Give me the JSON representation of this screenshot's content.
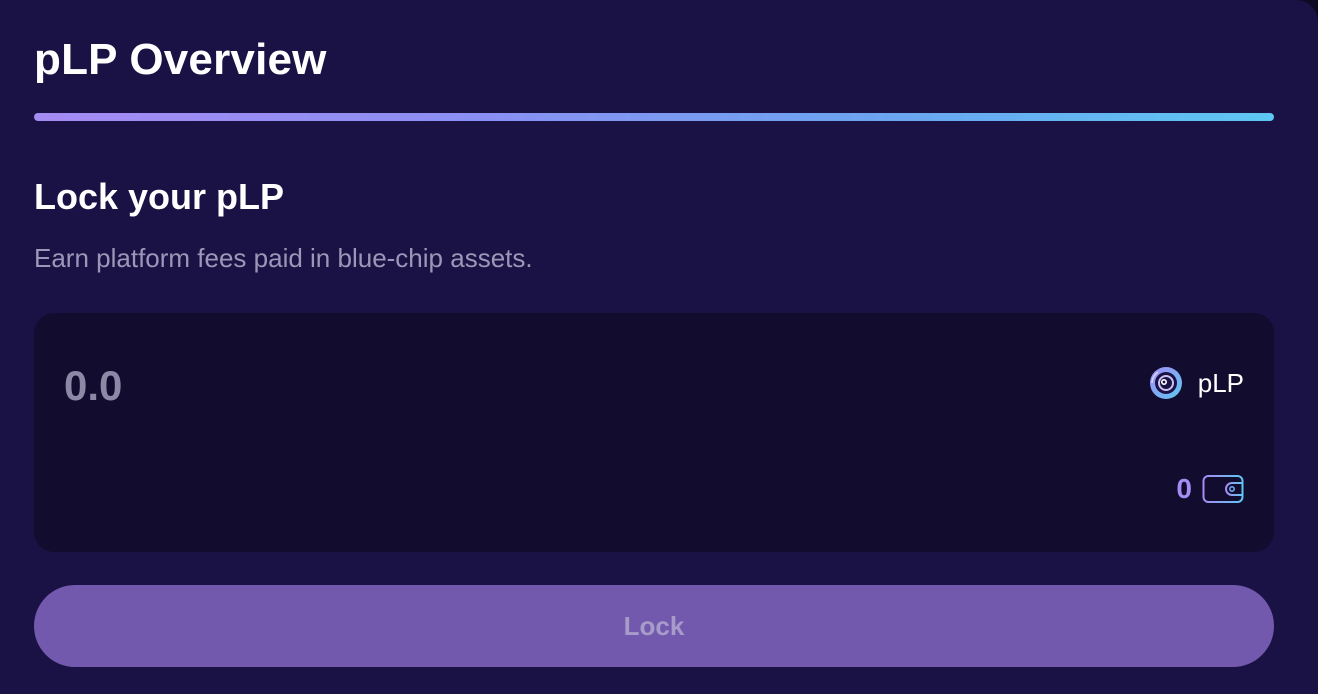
{
  "header": {
    "title": "pLP Overview"
  },
  "lock_section": {
    "title": "Lock your pLP",
    "subtitle": "Earn platform fees paid in blue-chip assets."
  },
  "amount_input": {
    "value": "",
    "placeholder": "0.0"
  },
  "token": {
    "label": "pLP",
    "icon": "plp-token-icon"
  },
  "balance": {
    "value": "0",
    "icon": "wallet-icon"
  },
  "actions": {
    "lock_label": "Lock"
  },
  "colors": {
    "background": "#1a1244",
    "card": "#120d2e",
    "accent": "#a58bf4",
    "gradient_start": "#a58bf4",
    "gradient_end": "#5ec7f3",
    "button": "#7259ae"
  }
}
